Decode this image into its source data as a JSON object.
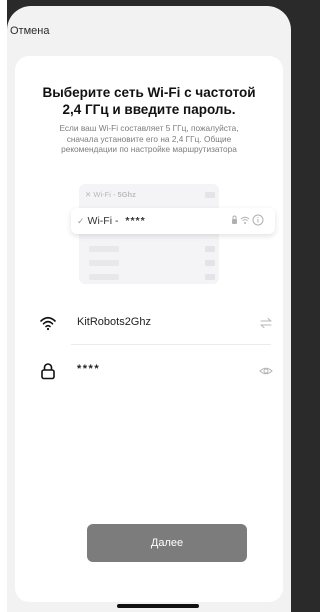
{
  "header": {
    "cancel_label": "Отмена"
  },
  "main": {
    "title": "Выберите сеть Wi-Fi с частотой\n2,4 ГГц и введите пароль.",
    "subtitle": "Если ваш Wi-Fi составляет 5 ГГц, пожалуйста,\nсначала установите его на 2,4 ГГц. Общие\nрекомендации по настройке маршрутизатора"
  },
  "illustration": {
    "row1_prefix": "✕ Wi-Fi - ",
    "row1_band": "5Ghz",
    "card_prefix": "Wi-Fi - ",
    "card_password": "****",
    "check_glyph": "✓"
  },
  "network": {
    "ssid": "KitRobots2Ghz",
    "icon": "wifi-icon",
    "action_icon": "swap-icon"
  },
  "password": {
    "value": "****",
    "icon": "lock-icon",
    "action_icon": "eye-icon"
  },
  "actions": {
    "next_label": "Далее"
  }
}
